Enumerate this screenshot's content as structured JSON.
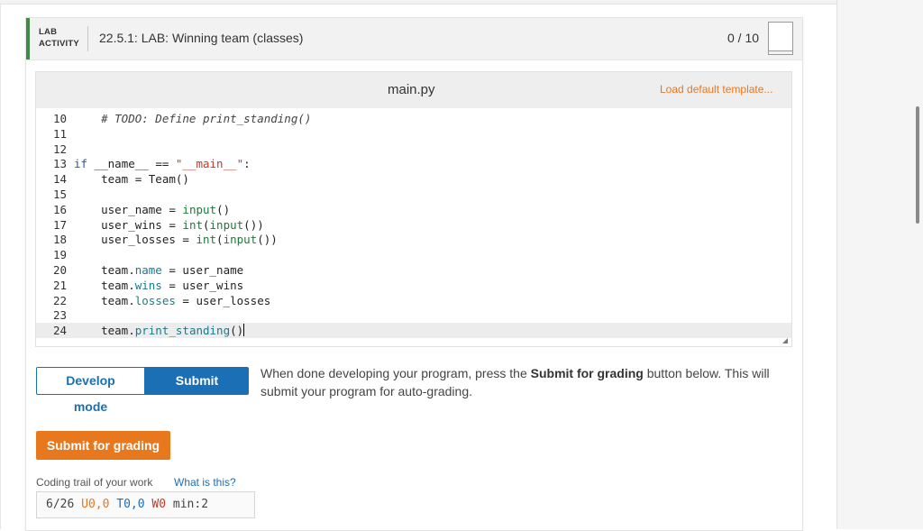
{
  "header": {
    "lab_line1": "LAB",
    "lab_line2": "ACTIVITY",
    "title": "22.5.1: LAB: Winning team (classes)",
    "score": "0 / 10"
  },
  "editor": {
    "file_name": "main.py",
    "load_template": "Load default template...",
    "lines": [
      {
        "n": "10",
        "code": "    # TODO: Define print_standing()"
      },
      {
        "n": "11",
        "code": ""
      },
      {
        "n": "12",
        "code": ""
      },
      {
        "n": "13",
        "code": "if __name__ == \"__main__\":"
      },
      {
        "n": "14",
        "code": "    team = Team()"
      },
      {
        "n": "15",
        "code": ""
      },
      {
        "n": "16",
        "code": "    user_name = input()"
      },
      {
        "n": "17",
        "code": "    user_wins = int(input())"
      },
      {
        "n": "18",
        "code": "    user_losses = int(input())"
      },
      {
        "n": "19",
        "code": ""
      },
      {
        "n": "20",
        "code": "    team.name = user_name"
      },
      {
        "n": "21",
        "code": "    team.wins = user_wins"
      },
      {
        "n": "22",
        "code": "    team.losses = user_losses"
      },
      {
        "n": "23",
        "code": ""
      },
      {
        "n": "24",
        "code": "    team.print_standing()"
      }
    ],
    "active_line": "24"
  },
  "modes": {
    "develop": "Develop mode",
    "submit": "Submit mode",
    "active": "submit"
  },
  "info": {
    "before": "When done developing your program, press the ",
    "bold": "Submit for grading",
    "after": " button below. This will submit your program for auto-grading."
  },
  "submit_button": "Submit for grading",
  "trail": {
    "label": "Coding trail of your work",
    "link": "What is this?",
    "prefix": "6/26 ",
    "u": "U0,0",
    "t": "T0,0",
    "w": "W0",
    "suffix": " min:2"
  },
  "colors": {
    "accent_green": "#3d8b40",
    "primary_blue": "#1b6fb5",
    "orange": "#e8781e"
  }
}
